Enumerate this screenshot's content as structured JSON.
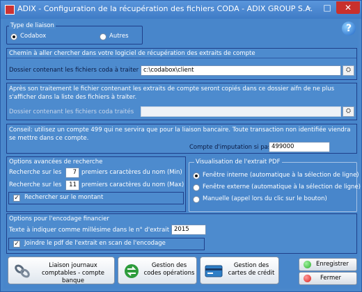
{
  "window": {
    "title": "ADIX - Configuration de la récupération des fichiers CODA - ADIX GROUP S.A.",
    "minimize": "–",
    "maximize": "□",
    "close": "✕"
  },
  "help_icon": "?",
  "type_liaison": {
    "legend": "Type de liaison",
    "options": [
      "Codabox",
      "Autres"
    ],
    "selected": "Codabox"
  },
  "chemin": {
    "description": "Chemin à aller chercher dans votre logiciel de récupération des extraits de compte",
    "folder_label": "Dossier contenant les fichiers coda à traiter",
    "folder_value": "c:\\codabox\\client"
  },
  "traites": {
    "description": "Après son traitement le fichier contenant les extraits de compte seront copiés dans ce dossier aifn de ne plus s'afficher dans la liste des fichiers à traiter.",
    "folder_label": "Dossier contenant les fichiers coda traités",
    "folder_value": ""
  },
  "conseil": {
    "text": "Conseil: utilisez un compte 499 qui ne servira que pour la liaison bancaire. Toute transaction non identifiée viendra se mettre dans ce compte.",
    "compte_label": "Compte d'imputation si pas trouvé",
    "compte_value": "499000"
  },
  "recherche": {
    "title": "Options avancées de recherche",
    "min_label_pre": "Recherche sur les",
    "min_value": "7",
    "min_label_post": "premiers caractères du nom (Min)",
    "max_label_pre": "Recherche sur les",
    "max_value": "11",
    "max_label_post": "premiers caractères du nom (Max)",
    "montant_label": "Rechercher sur le montant",
    "montant_checked": true
  },
  "visualisation": {
    "legend": "Visualisation de l'extrait PDF",
    "options": [
      "Fenêtre interne (automatique à la sélection de ligne)",
      "Fenêtre externe (automatique à la sélection de ligne)",
      "Manuelle (appel lors du clic sur le bouton)"
    ],
    "selected_index": 0
  },
  "encodage": {
    "title": "Options pour l'encodage financier",
    "millesime_label": "Texte à indiquer comme millésime dans le n° d'extrait",
    "millesime_value": "2015",
    "joindre_label": "Joindre le pdf de l'extrait en scan de l'encodage",
    "joindre_checked": true
  },
  "buttons": {
    "liaison": "Liaison journaux comptables - compte banque",
    "codes": "Gestion des codes opérations",
    "cartes": "Gestion des cartes de crédit",
    "enregistrer": "Enregistrer",
    "fermer": "Fermer"
  },
  "colors": {
    "panel_bg": "#4d8bce",
    "title_bar": "#3f7cc6",
    "close_red": "#c9302c",
    "save_green": "#2fae2f",
    "close_dot_red": "#d9241e"
  },
  "icons": [
    "app-icon",
    "help-icon",
    "browse-folder-icon",
    "link-icon",
    "operations-icon",
    "credit-card-icon",
    "green-dot-icon",
    "red-dot-icon"
  ]
}
